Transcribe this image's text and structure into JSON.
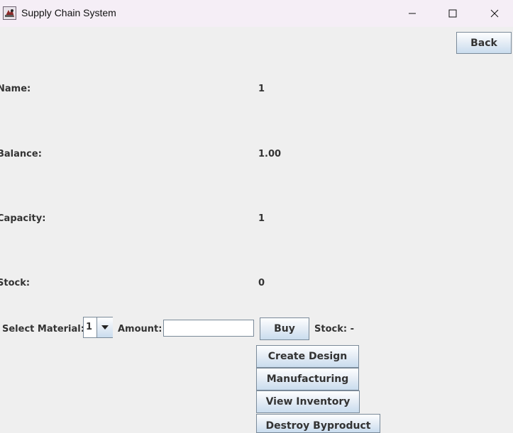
{
  "window": {
    "title": "Supply Chain System",
    "icons": [
      "app-icon",
      "minimize-icon",
      "maximize-icon",
      "close-icon"
    ]
  },
  "header": {
    "back_label": "Back"
  },
  "info": {
    "name_label": "Name:",
    "name_value": "1",
    "balance_label": "Balance:",
    "balance_value": "1.00",
    "capacity_label": "Capacity:",
    "capacity_value": "1",
    "stock_label": "Stock:",
    "stock_value": "0"
  },
  "purchase": {
    "select_material_label": "Select Material:",
    "material_selected": "1",
    "amount_label": "Amount:",
    "amount_value": "",
    "buy_label": "Buy",
    "stock_label": "Stock: -"
  },
  "actions": {
    "create_design": "Create Design",
    "manufacturing": "Manufacturing",
    "view_inventory": "View Inventory",
    "destroy_byproduct": "Destroy Byproduct"
  },
  "colors": {
    "background": "#efefef",
    "titlebar": "#f5eef6",
    "button_gradient_top": "#fdfeff",
    "button_gradient_bottom": "#c9dcee",
    "button_border": "#7a8a99",
    "text": "#333333"
  }
}
